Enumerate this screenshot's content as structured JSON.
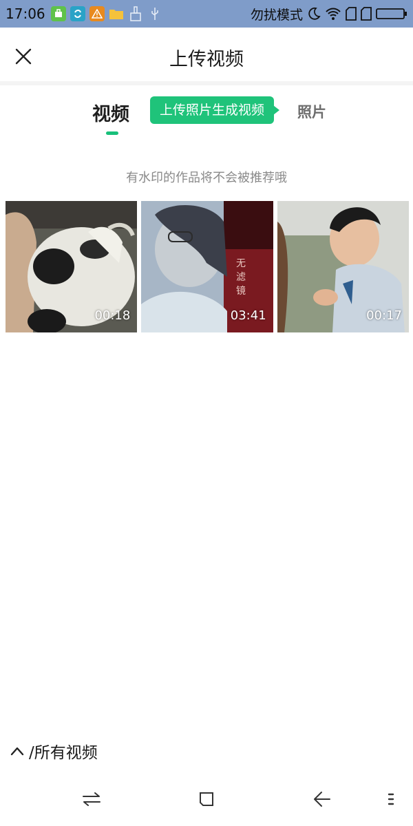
{
  "status_bar": {
    "time": "17:06",
    "dnd_label": "勿扰模式",
    "icons": [
      "app-store-icon",
      "sync-app-icon",
      "warning-icon",
      "folder-icon",
      "broom-icon",
      "usb-icon",
      "moon-icon",
      "wifi-icon",
      "sim1-icon",
      "sim2-icon",
      "battery-icon"
    ]
  },
  "header": {
    "title": "上传视频",
    "close_icon": "close-icon"
  },
  "tabs": {
    "video": "视频",
    "photo_tooltip": "上传照片生成视频",
    "photo": "照片",
    "active_color": "#19c07a"
  },
  "hint": "有水印的作品将不会被推荐哦",
  "videos": [
    {
      "duration": "00:18",
      "subject": "cat"
    },
    {
      "duration": "03:41",
      "subject": "portrait"
    },
    {
      "duration": "00:17",
      "subject": "child"
    }
  ],
  "album": {
    "label": "/所有视频",
    "icon": "chevron-up-icon"
  },
  "navbar": {
    "icons": [
      "switch-icon",
      "home-square-icon",
      "back-icon",
      "menu-icon"
    ]
  }
}
